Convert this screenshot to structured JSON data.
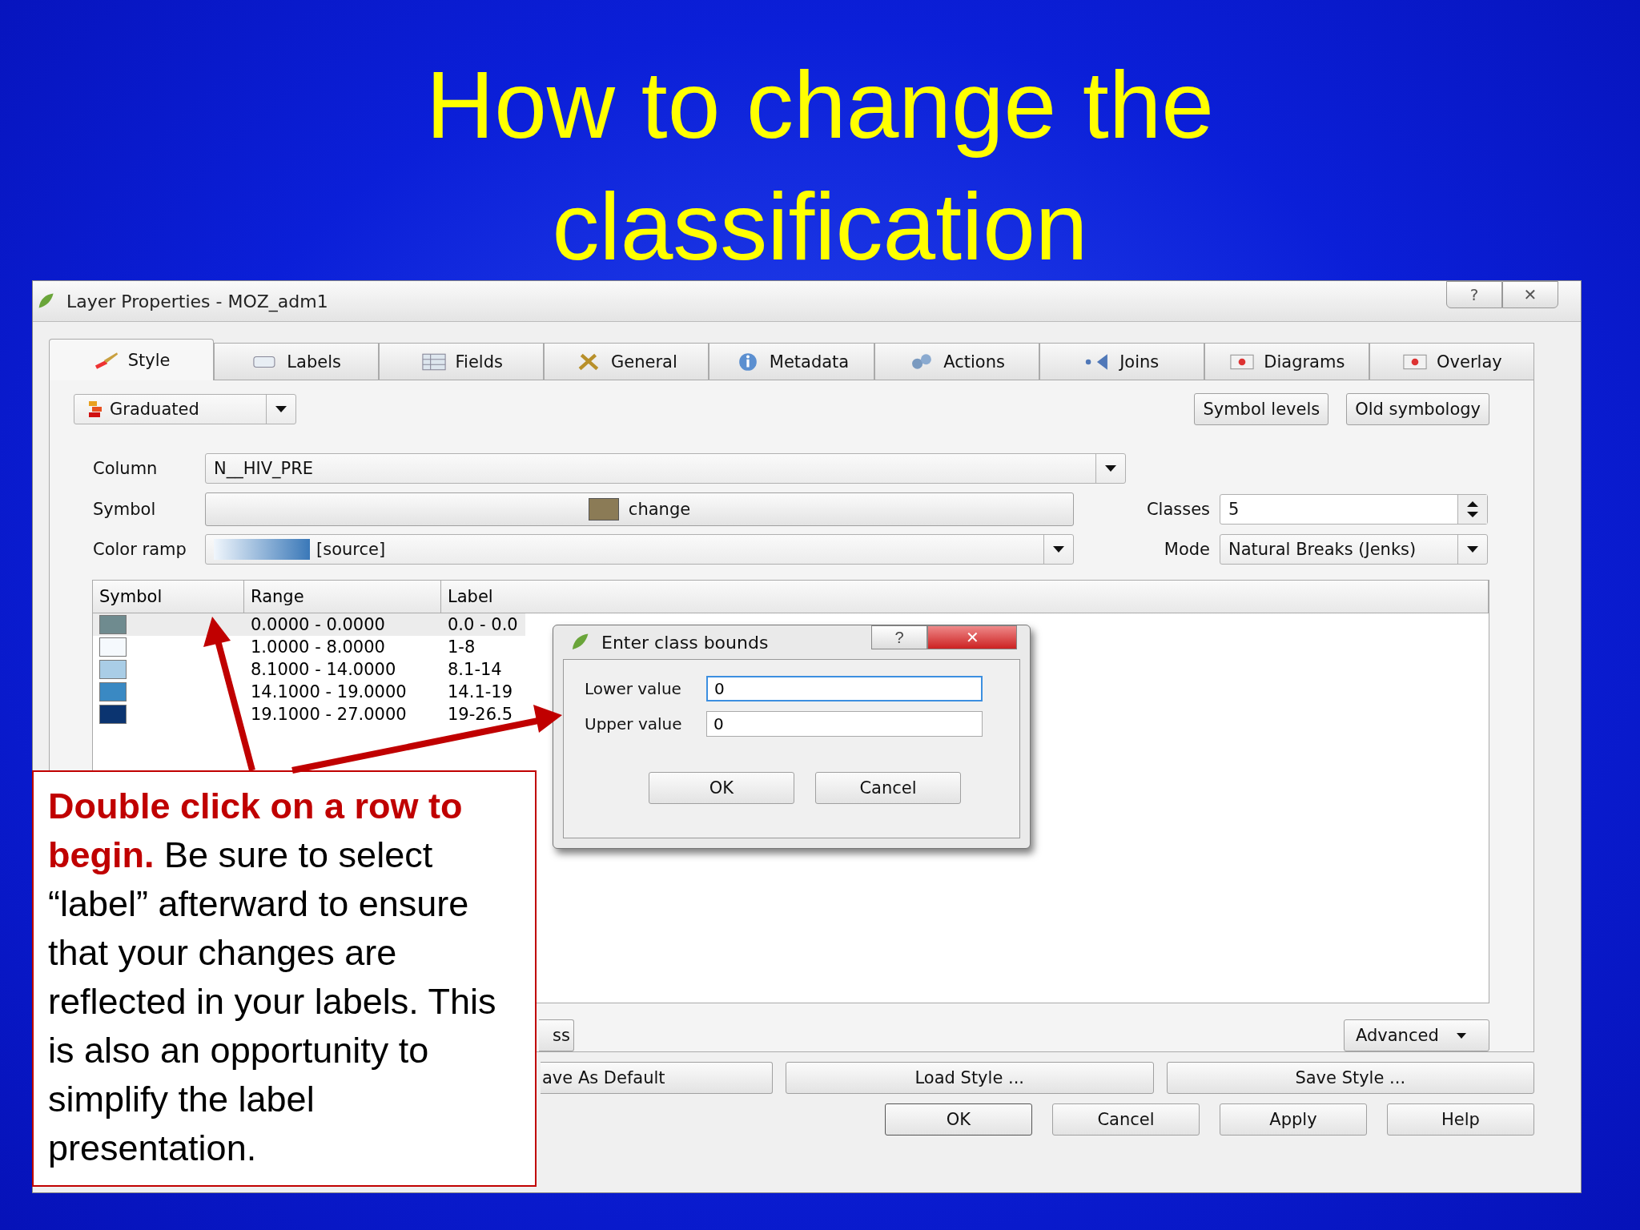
{
  "slide": {
    "title": "How to change the classification"
  },
  "window": {
    "title": "Layer Properties - MOZ_adm1",
    "help": "?",
    "close": "✕"
  },
  "tabs": [
    {
      "label": "Style",
      "selected": true
    },
    {
      "label": "Labels",
      "selected": false
    },
    {
      "label": "Fields",
      "selected": false
    },
    {
      "label": "General",
      "selected": false
    },
    {
      "label": "Metadata",
      "selected": false
    },
    {
      "label": "Actions",
      "selected": false
    },
    {
      "label": "Joins",
      "selected": false
    },
    {
      "label": "Diagrams",
      "selected": false
    },
    {
      "label": "Overlay",
      "selected": false
    }
  ],
  "style": {
    "renderer": "Graduated",
    "top_buttons": [
      "Symbol levels",
      "Old symbology"
    ],
    "column": {
      "label": "Column",
      "value": "N__HIV_PRE"
    },
    "symbol": {
      "label": "Symbol",
      "button": "change"
    },
    "color_ramp": {
      "label": "Color ramp",
      "value": "[source]"
    },
    "classes": {
      "label": "Classes",
      "value": "5"
    },
    "mode": {
      "label": "Mode",
      "value": "Natural Breaks (Jenks)"
    }
  },
  "table": {
    "columns": [
      "Symbol",
      "Range",
      "Label"
    ],
    "rows": [
      {
        "color": "#6f8b8f",
        "range": "0.0000 - 0.0000",
        "label": "0.0 - 0.0",
        "selected": true
      },
      {
        "color": "#f5f9fd",
        "range": "1.0000 - 8.0000",
        "label": "1-8",
        "selected": false
      },
      {
        "color": "#a9cde6",
        "range": "8.1000 - 14.0000",
        "label": "8.1-14",
        "selected": false
      },
      {
        "color": "#3a89c3",
        "range": "14.1000 - 19.0000",
        "label": "14.1-19",
        "selected": false
      },
      {
        "color": "#0b3470",
        "range": "19.1000 - 27.0000",
        "label": "19-26.5",
        "selected": false
      }
    ]
  },
  "class_buttons": {
    "delete_fragment": "ss",
    "advanced": "Advanced"
  },
  "style_buttons": {
    "save_default_fragment": "ave As Default",
    "load": "Load Style ...",
    "save": "Save Style ..."
  },
  "dialog_buttons": [
    "OK",
    "Cancel",
    "Apply",
    "Help"
  ],
  "bounds_dialog": {
    "title": "Enter class bounds",
    "help": "?",
    "close": "✕",
    "fields": [
      {
        "label": "Lower value",
        "value": "0",
        "focused": true
      },
      {
        "label": "Upper value",
        "value": "0",
        "focused": false
      }
    ],
    "buttons": [
      "OK",
      "Cancel"
    ]
  },
  "callout": {
    "text": "**Double click on a row to begin.**  Be sure to select “label” afterward to ensure that your changes are reflected in your labels. This is also an opportunity to simplify the label presentation."
  }
}
